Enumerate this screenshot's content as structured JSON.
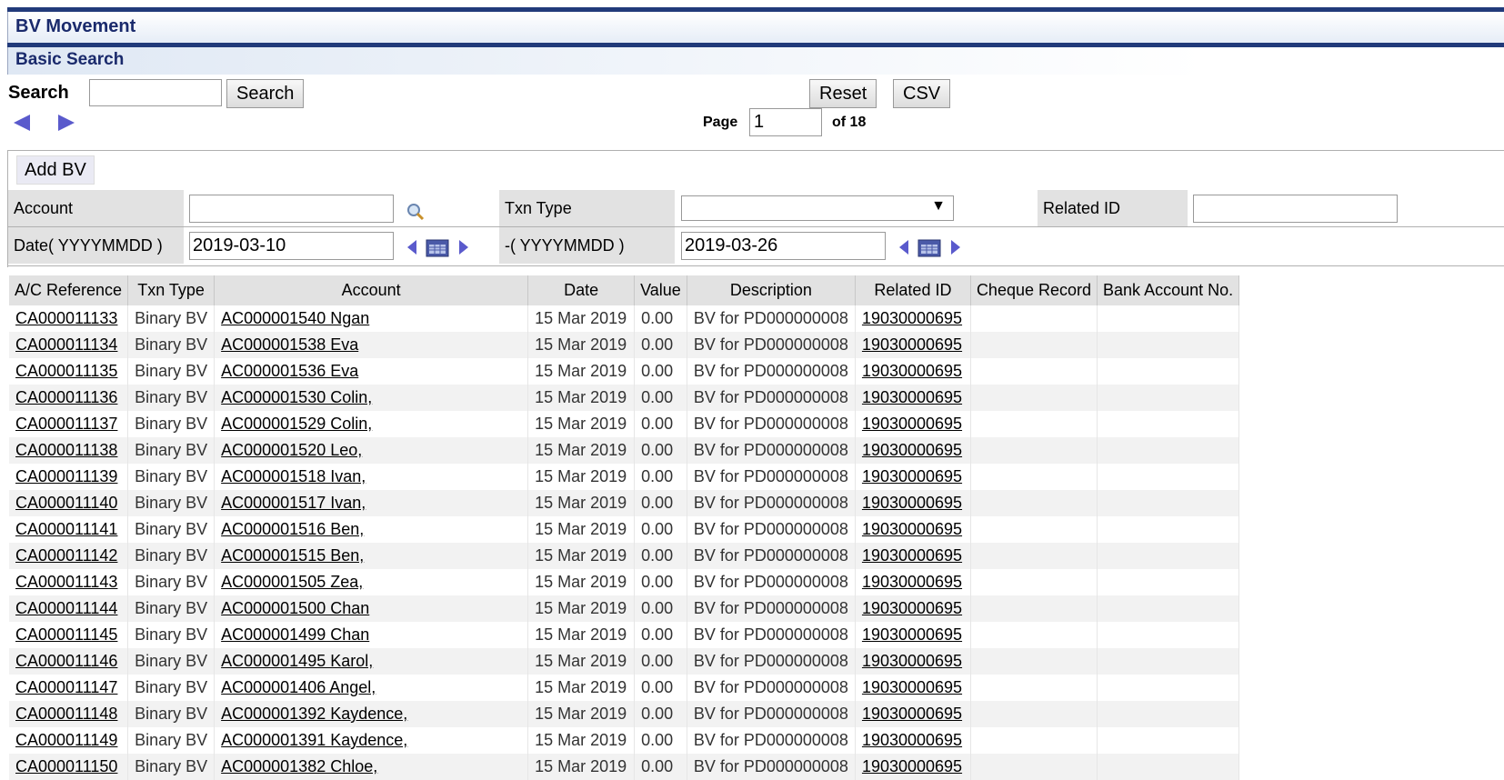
{
  "window": {
    "title": "BV Movement"
  },
  "section": {
    "title": "Basic Search"
  },
  "search": {
    "label": "Search",
    "value": "",
    "button_label": "Search"
  },
  "toolbar": {
    "reset_label": "Reset",
    "csv_label": "CSV"
  },
  "pagination": {
    "page_label": "Page",
    "current_page": "1",
    "of_label": "of 18"
  },
  "filters": {
    "add_bv_label": "Add BV",
    "account_label": "Account",
    "account_value": "",
    "txn_type_label": "Txn Type",
    "txn_type_value": "",
    "related_id_label": "Related ID",
    "related_id_value": "",
    "date_from_label": "Date( YYYYMMDD )",
    "date_from_value": "2019-03-10",
    "date_to_label": "-( YYYYMMDD )",
    "date_to_value": "2019-03-26"
  },
  "table": {
    "columns": [
      "A/C Reference",
      "Txn Type",
      "Account",
      "Date",
      "Value",
      "Description",
      "Related ID",
      "Cheque Record",
      "Bank Account No."
    ],
    "rows": [
      {
        "ref": "CA000011133",
        "type": "Binary BV",
        "account": "AC000001540  Ngan",
        "date": "15 Mar 2019",
        "value": "0.00",
        "desc": "BV for PD000000008",
        "related": "19030000695"
      },
      {
        "ref": "CA000011134",
        "type": "Binary BV",
        "account": "AC000001538  Eva",
        "date": "15 Mar 2019",
        "value": "0.00",
        "desc": "BV for PD000000008",
        "related": "19030000695"
      },
      {
        "ref": "CA000011135",
        "type": "Binary BV",
        "account": "AC000001536  Eva",
        "date": "15 Mar 2019",
        "value": "0.00",
        "desc": "BV for PD000000008",
        "related": "19030000695"
      },
      {
        "ref": "CA000011136",
        "type": "Binary BV",
        "account": "AC000001530  Colin,",
        "date": "15 Mar 2019",
        "value": "0.00",
        "desc": "BV for PD000000008",
        "related": "19030000695"
      },
      {
        "ref": "CA000011137",
        "type": "Binary BV",
        "account": "AC000001529  Colin,",
        "date": "15 Mar 2019",
        "value": "0.00",
        "desc": "BV for PD000000008",
        "related": "19030000695"
      },
      {
        "ref": "CA000011138",
        "type": "Binary BV",
        "account": "AC000001520  Leo,",
        "date": "15 Mar 2019",
        "value": "0.00",
        "desc": "BV for PD000000008",
        "related": "19030000695"
      },
      {
        "ref": "CA000011139",
        "type": "Binary BV",
        "account": "AC000001518  Ivan,",
        "date": "15 Mar 2019",
        "value": "0.00",
        "desc": "BV for PD000000008",
        "related": "19030000695"
      },
      {
        "ref": "CA000011140",
        "type": "Binary BV",
        "account": "AC000001517  Ivan,",
        "date": "15 Mar 2019",
        "value": "0.00",
        "desc": "BV for PD000000008",
        "related": "19030000695"
      },
      {
        "ref": "CA000011141",
        "type": "Binary BV",
        "account": "AC000001516  Ben,",
        "date": "15 Mar 2019",
        "value": "0.00",
        "desc": "BV for PD000000008",
        "related": "19030000695"
      },
      {
        "ref": "CA000011142",
        "type": "Binary BV",
        "account": "AC000001515  Ben,",
        "date": "15 Mar 2019",
        "value": "0.00",
        "desc": "BV for PD000000008",
        "related": "19030000695"
      },
      {
        "ref": "CA000011143",
        "type": "Binary BV",
        "account": "AC000001505  Zea,",
        "date": "15 Mar 2019",
        "value": "0.00",
        "desc": "BV for PD000000008",
        "related": "19030000695"
      },
      {
        "ref": "CA000011144",
        "type": "Binary BV",
        "account": "AC000001500  Chan",
        "date": "15 Mar 2019",
        "value": "0.00",
        "desc": "BV for PD000000008",
        "related": "19030000695"
      },
      {
        "ref": "CA000011145",
        "type": "Binary BV",
        "account": "AC000001499  Chan",
        "date": "15 Mar 2019",
        "value": "0.00",
        "desc": "BV for PD000000008",
        "related": "19030000695"
      },
      {
        "ref": "CA000011146",
        "type": "Binary BV",
        "account": "AC000001495  Karol,",
        "date": "15 Mar 2019",
        "value": "0.00",
        "desc": "BV for PD000000008",
        "related": "19030000695"
      },
      {
        "ref": "CA000011147",
        "type": "Binary BV",
        "account": "AC000001406  Angel,",
        "date": "15 Mar 2019",
        "value": "0.00",
        "desc": "BV for PD000000008",
        "related": "19030000695"
      },
      {
        "ref": "CA000011148",
        "type": "Binary BV",
        "account": "AC000001392  Kaydence,",
        "date": "15 Mar 2019",
        "value": "0.00",
        "desc": "BV for PD000000008",
        "related": "19030000695"
      },
      {
        "ref": "CA000011149",
        "type": "Binary BV",
        "account": "AC000001391  Kaydence,",
        "date": "15 Mar 2019",
        "value": "0.00",
        "desc": "BV for PD000000008",
        "related": "19030000695"
      },
      {
        "ref": "CA000011150",
        "type": "Binary BV",
        "account": "AC000001382  Chloe,",
        "date": "15 Mar 2019",
        "value": "0.00",
        "desc": "BV for PD000000008",
        "related": "19030000695"
      }
    ]
  },
  "icons": {
    "prev": "arrow-left-icon",
    "next": "arrow-right-icon",
    "lookup": "magnifier-icon",
    "calendar": "calendar-icon",
    "accent": "#5a5acc"
  }
}
